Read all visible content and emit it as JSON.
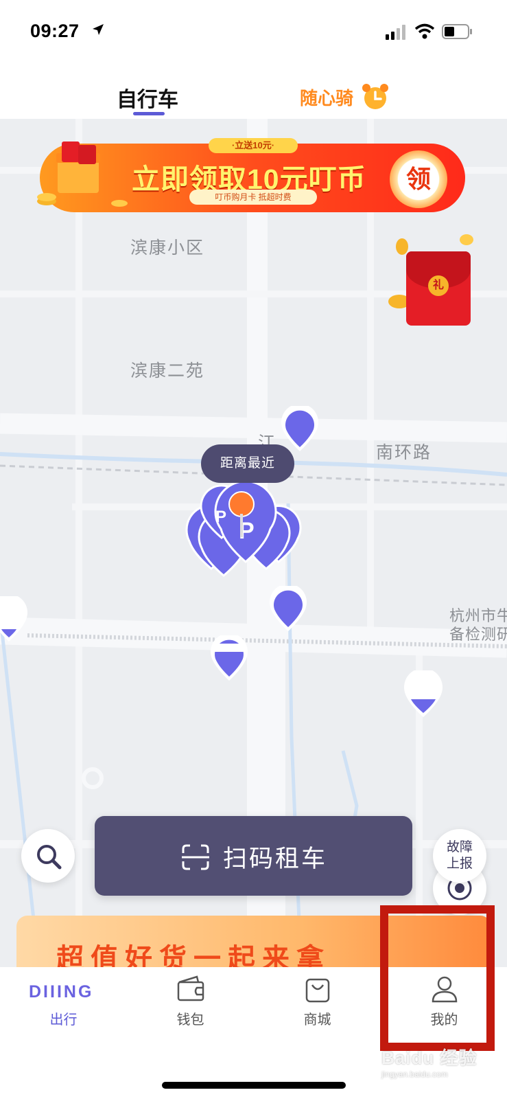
{
  "status_bar": {
    "time": "09:27"
  },
  "top_tabs": {
    "bike": "自行车",
    "ride": "随心骑"
  },
  "promo_banner": {
    "tag": "·立送10元·",
    "title": "立即领取10元叮币",
    "subtitle": "叮币购月卡  抵超时费",
    "button": "领"
  },
  "envelope": {
    "seal": "礼"
  },
  "map": {
    "labels": {
      "binkang_xiaoqu": "滨康小区",
      "binkang_eryuan": "滨康二苑",
      "jiang": "江",
      "nanhuan_road": "南环路",
      "hangzhou_station": "杭州市牛\n备检测研"
    },
    "nearest_tooltip": "距离最近",
    "parking_letter": "P"
  },
  "controls": {
    "scan_button": "扫码租车",
    "report_button": "故障\n上报"
  },
  "bottom_promo": {
    "text": "超值好货一起来拿"
  },
  "tab_bar": {
    "logo": "DIIING",
    "items": [
      {
        "label": "出行",
        "active": true
      },
      {
        "label": "钱包",
        "active": false
      },
      {
        "label": "商城",
        "active": false
      },
      {
        "label": "我的",
        "active": false
      }
    ]
  },
  "watermark": {
    "brand": "Baidu 经验",
    "url": "jingyan.baidu.com"
  },
  "colors": {
    "accent": "#5c5ad6",
    "scan_button": "#524f73",
    "map_bg": "#eceef1",
    "highlight": "#c21a0e",
    "orange": "#ff8a1e"
  }
}
